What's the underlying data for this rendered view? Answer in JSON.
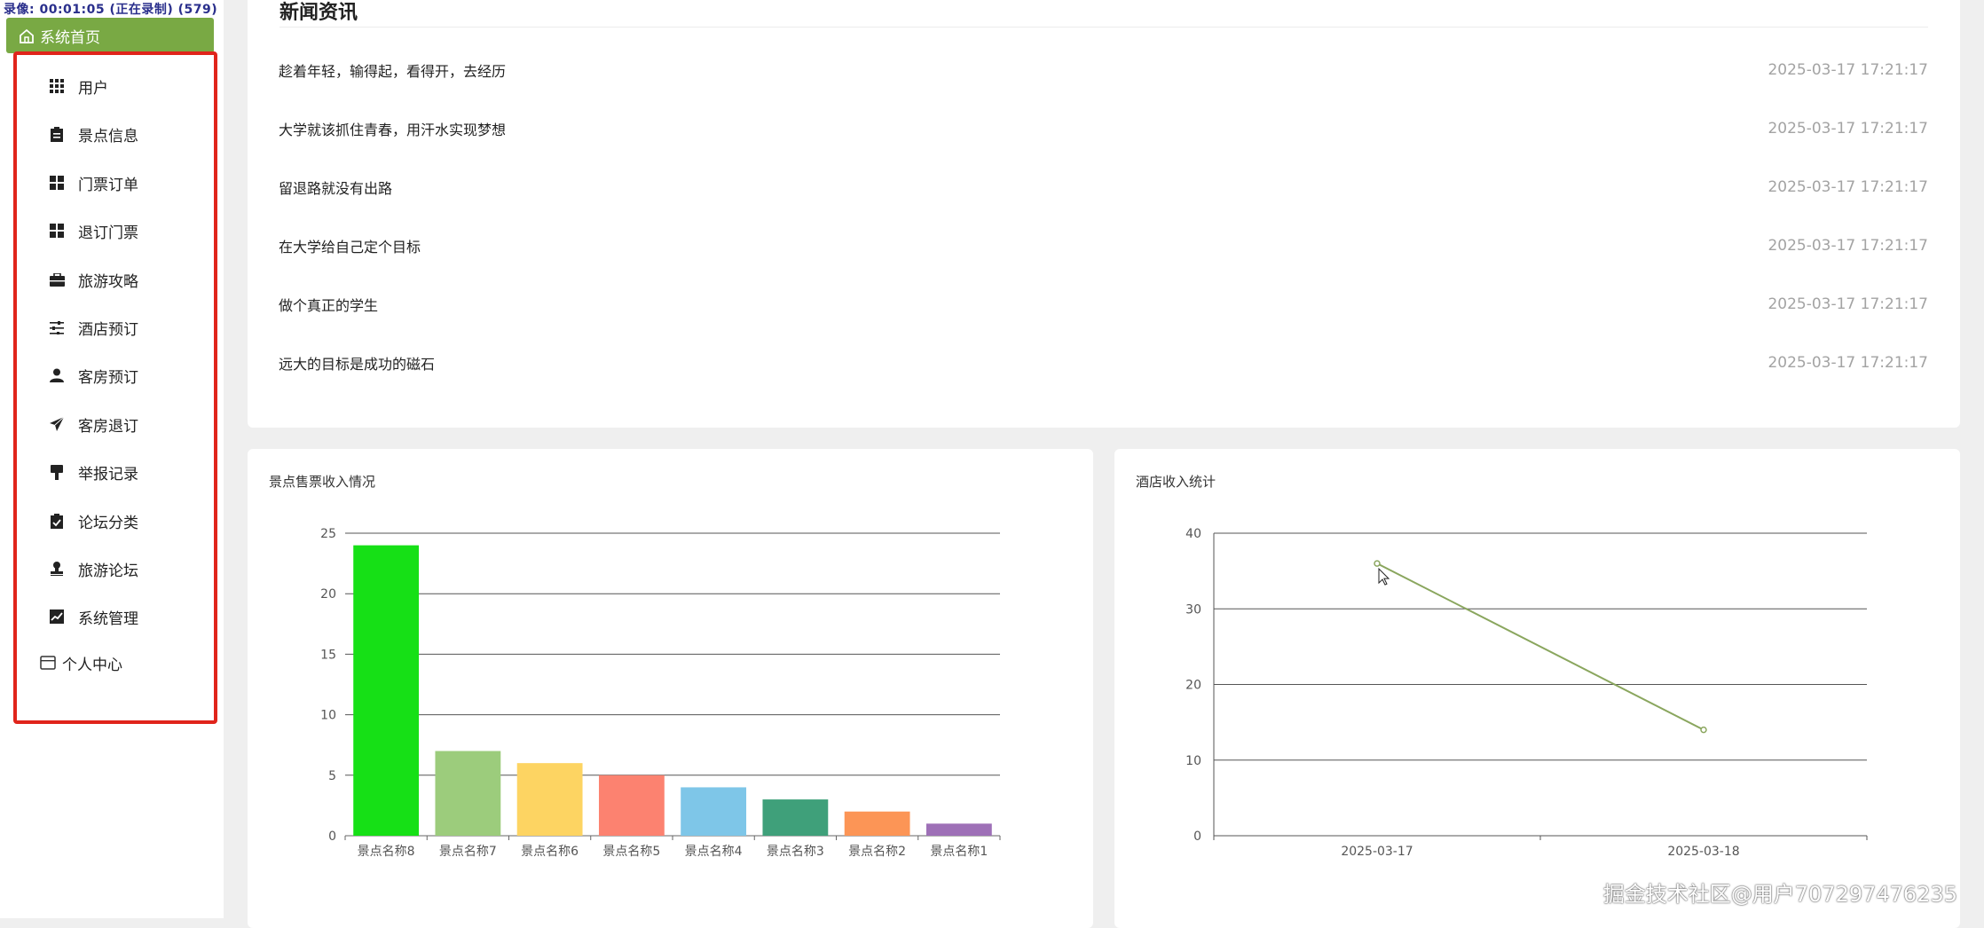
{
  "recording_label": "录像: 00:01:05 (正在录制) (579)",
  "sidebar": {
    "home_label": "系统首页",
    "items": [
      {
        "label": "用户",
        "icon": "grid-icon"
      },
      {
        "label": "景点信息",
        "icon": "clipboard-icon"
      },
      {
        "label": "门票订单",
        "icon": "tiles-icon"
      },
      {
        "label": "退订门票",
        "icon": "tiles-icon"
      },
      {
        "label": "旅游攻略",
        "icon": "briefcase-icon"
      },
      {
        "label": "酒店预订",
        "icon": "sliders-icon"
      },
      {
        "label": "客房预订",
        "icon": "user-icon"
      },
      {
        "label": "客房退订",
        "icon": "send-icon"
      },
      {
        "label": "举报记录",
        "icon": "brush-icon"
      },
      {
        "label": "论坛分类",
        "icon": "clipboard-check-icon"
      },
      {
        "label": "旅游论坛",
        "icon": "stamp-icon"
      },
      {
        "label": "系统管理",
        "icon": "chart-line-icon"
      }
    ],
    "personal_label": "个人中心",
    "accent_color": "#79a944",
    "highlight_color": "#e0241b"
  },
  "news": {
    "title": "新闻资讯",
    "items": [
      {
        "title": "趁着年轻，输得起，看得开，去经历",
        "date": "2025-03-17 17:21:17"
      },
      {
        "title": "大学就该抓住青春，用汗水实现梦想",
        "date": "2025-03-17 17:21:17"
      },
      {
        "title": "留退路就没有出路",
        "date": "2025-03-17 17:21:17"
      },
      {
        "title": "在大学给自己定个目标",
        "date": "2025-03-17 17:21:17"
      },
      {
        "title": "做个真正的学生",
        "date": "2025-03-17 17:21:17"
      },
      {
        "title": "远大的目标是成功的磁石",
        "date": "2025-03-17 17:21:17"
      }
    ]
  },
  "chart_data": [
    {
      "type": "bar",
      "title": "景点售票收入情况",
      "categories": [
        "景点名称8",
        "景点名称7",
        "景点名称6",
        "景点名称5",
        "景点名称4",
        "景点名称3",
        "景点名称2",
        "景点名称1"
      ],
      "values": [
        24,
        7,
        6,
        5,
        4,
        3,
        2,
        1
      ],
      "colors": [
        "#16e016",
        "#9ccc7c",
        "#fdd462",
        "#fc8270",
        "#7ec6e8",
        "#3fa07a",
        "#fc9556",
        "#9e70b7"
      ],
      "ylim": [
        0,
        25
      ],
      "yticks": [
        0,
        5,
        10,
        15,
        20,
        25
      ],
      "grid": true,
      "xlabel": "",
      "ylabel": ""
    },
    {
      "type": "line",
      "title": "酒店收入统计",
      "x": [
        "2025-03-17",
        "2025-03-18"
      ],
      "values": [
        36,
        14
      ],
      "color": "#8aa65e",
      "ylim": [
        0,
        40
      ],
      "yticks": [
        0,
        10,
        20,
        30,
        40
      ],
      "grid": true,
      "xlabel": "",
      "ylabel": ""
    }
  ],
  "watermark": "掘金技术社区@用户707297476235"
}
